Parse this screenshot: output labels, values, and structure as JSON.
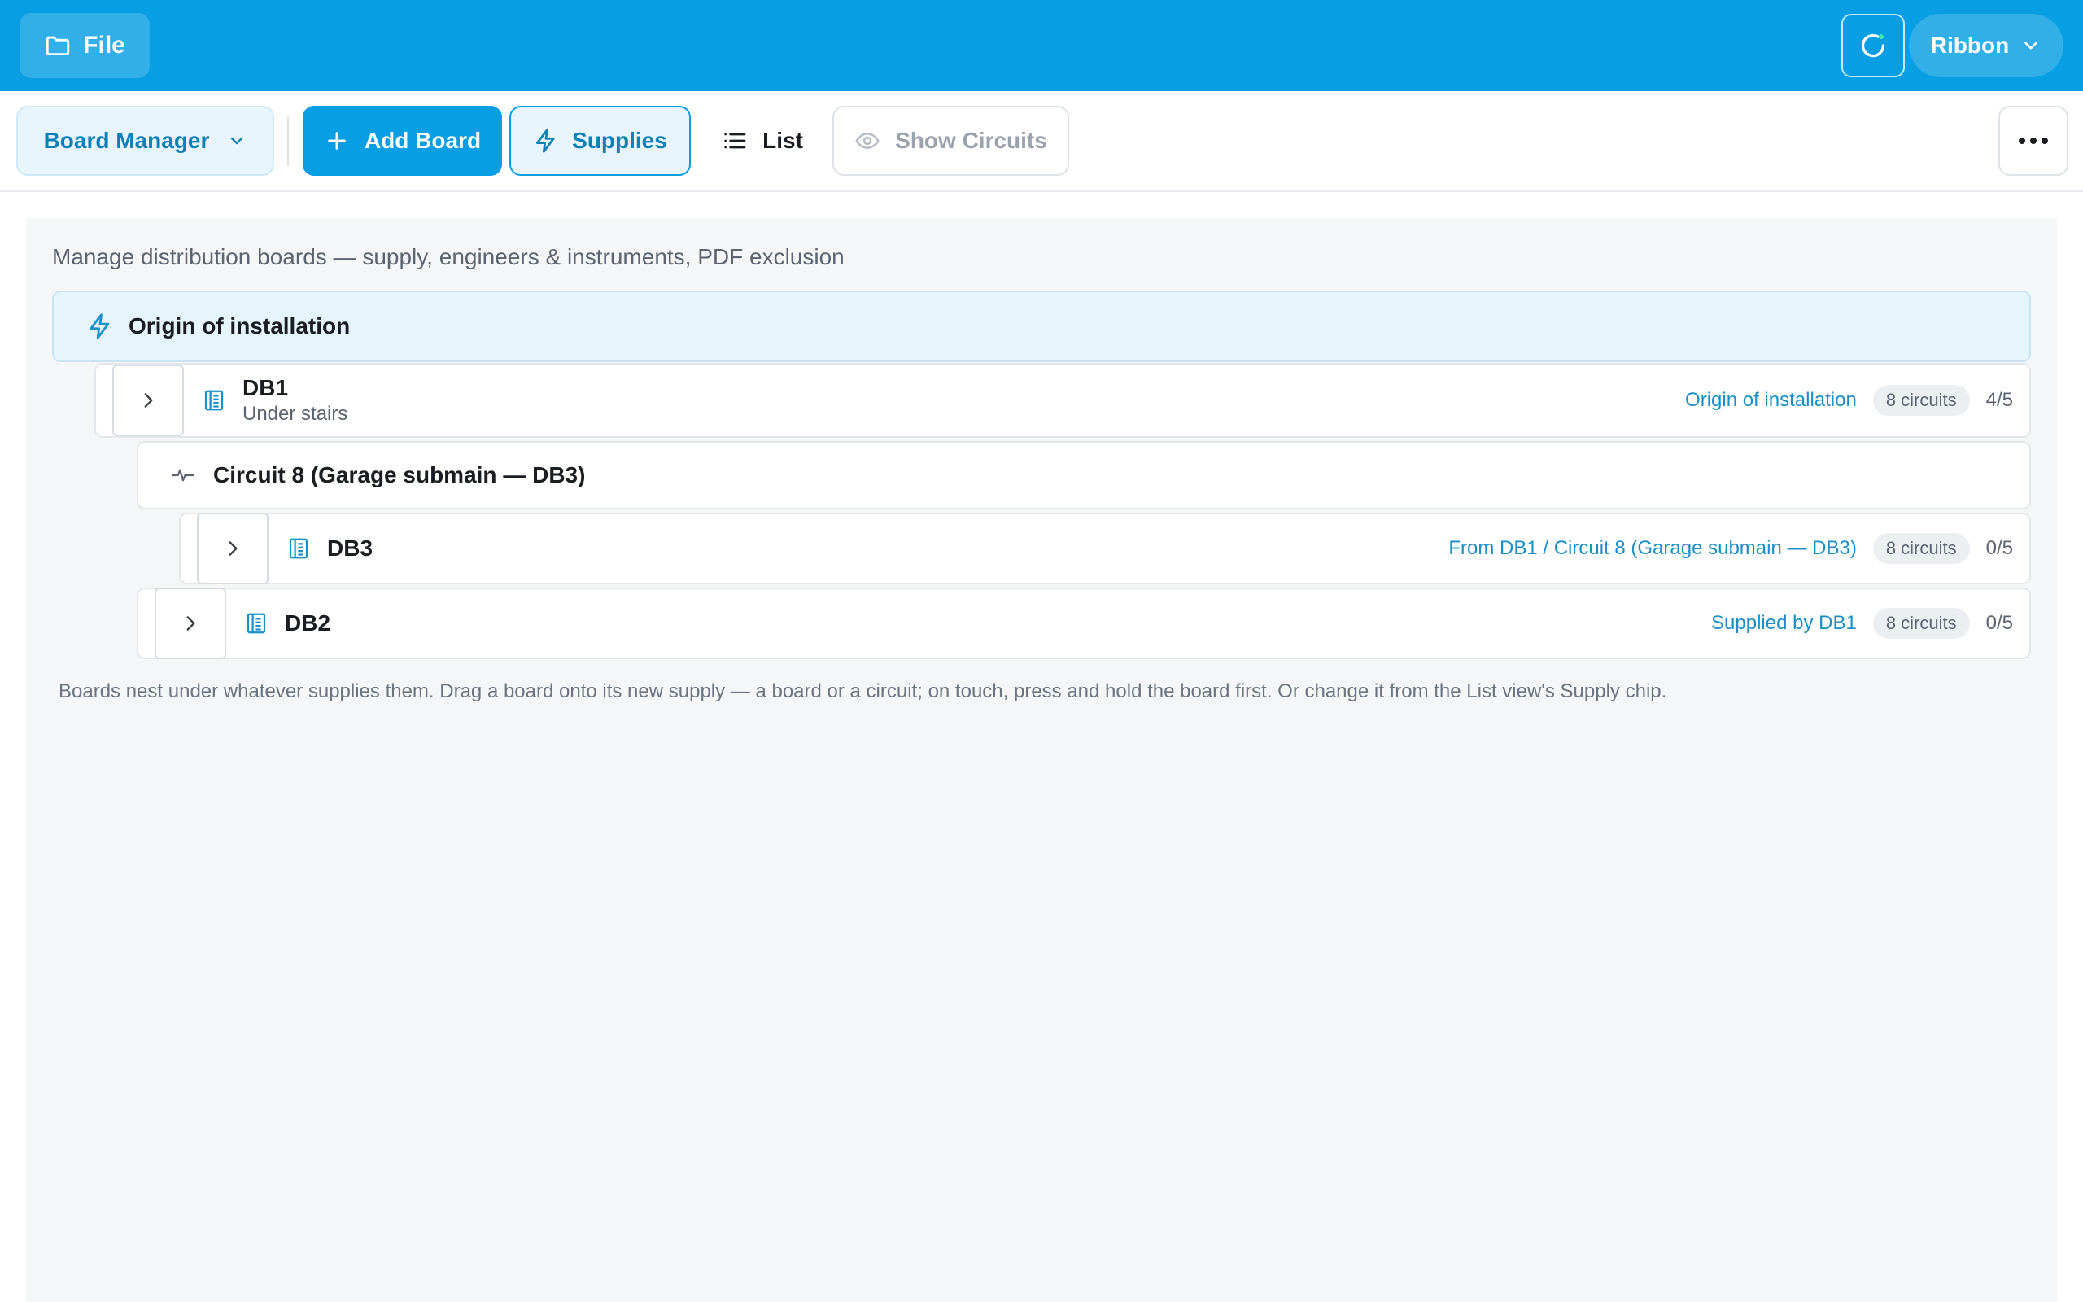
{
  "topbar": {
    "file_label": "File",
    "ribbon_label": "Ribbon",
    "accent": "#079ee3"
  },
  "toolbar": {
    "board_manager_label": "Board Manager",
    "add_board_label": "Add Board",
    "supplies_label": "Supplies",
    "list_label": "List",
    "show_circuits_label": "Show Circuits"
  },
  "main": {
    "description": "Manage distribution boards — supply, engineers & instruments, PDF exclusion",
    "origin_label": "Origin of installation",
    "boards": [
      {
        "name": "DB1",
        "location": "Under stairs",
        "supply": "Origin of installation",
        "circuits": "8 circuits",
        "progress": "4/5"
      },
      {
        "name": "DB3",
        "location": "",
        "supply": "From DB1 / Circuit 8 (Garage submain — DB3)",
        "circuits": "8 circuits",
        "progress": "0/5"
      },
      {
        "name": "DB2",
        "location": "",
        "supply": "Supplied by DB1",
        "circuits": "8 circuits",
        "progress": "0/5"
      }
    ],
    "circuit_label": "Circuit 8 (Garage submain — DB3)",
    "hint": "Boards nest under whatever supplies them. Drag a board onto its new supply — a board or a circuit; on touch, press and hold the board first. Or change it from the List view's Supply chip."
  },
  "icons": {
    "file": "folder-icon",
    "sync": "sync-icon",
    "ribbon": "chevron-down-icon",
    "board_manager": "chevron-down-icon",
    "add_board": "plus-icon",
    "supplies": "lightning-icon",
    "list": "list-icon",
    "show_circuits": "eye-icon",
    "more": "more-icon",
    "origin": "lightning-icon",
    "board": "board-icon",
    "expand": "chevron-right-icon",
    "circuit": "pulse-icon"
  }
}
